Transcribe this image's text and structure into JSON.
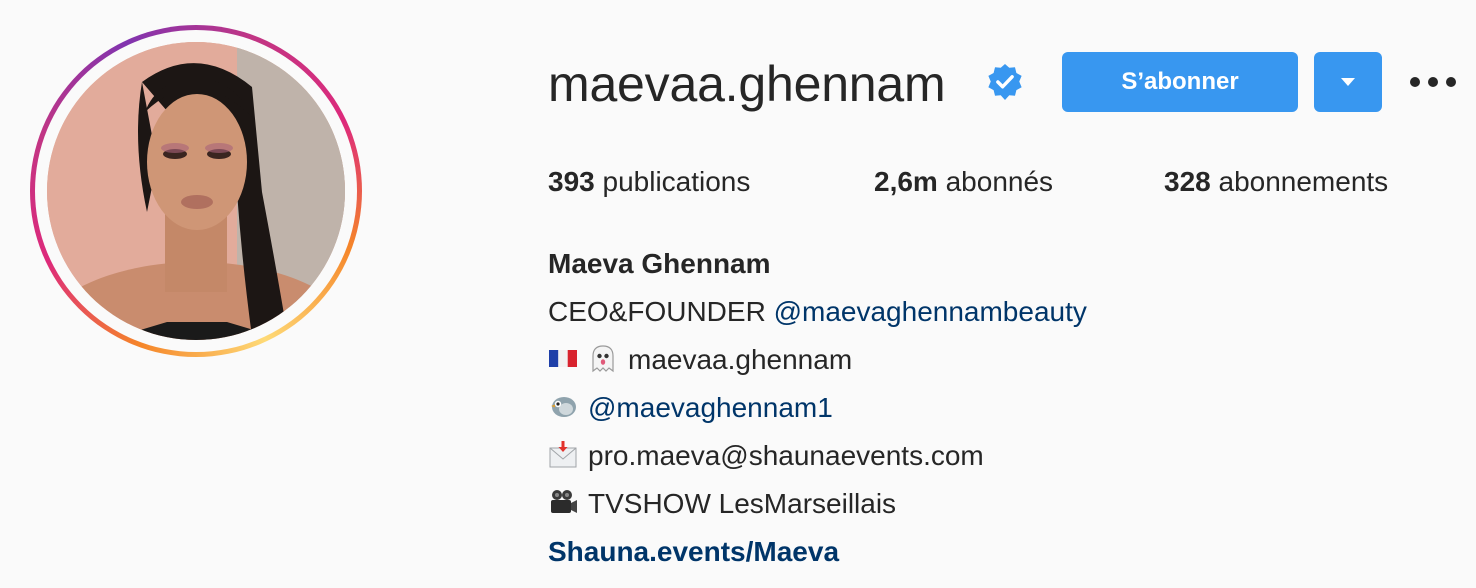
{
  "profile": {
    "username": "maevaa.ghennam",
    "verified": true,
    "follow_label": "S’abonner",
    "accent_color": "#3897f0",
    "link_color": "#003569"
  },
  "stats": {
    "posts_count": "393",
    "posts_label": "publications",
    "followers_count": "2,6m",
    "followers_label": "abonnés",
    "following_count": "328",
    "following_label": "abonnements"
  },
  "bio": {
    "full_name": "Maeva Ghennam",
    "line1_prefix": "CEO&FOUNDER",
    "line1_mention": "@maevaghennambeauty",
    "line2_text": "maevaa.ghennam",
    "line3_mention": "@maevaghennam1",
    "line4_text": "pro.maeva@shaunaevents.com",
    "line5_text": "TVSHOW LesMarseillais",
    "website": "Shauna.events/Maeva"
  },
  "icons": [
    "verified-badge-icon",
    "chevron-down-icon",
    "more-options-icon",
    "france-flag-icon",
    "ghost-icon",
    "bird-icon",
    "envelope-icon",
    "movie-camera-icon"
  ]
}
